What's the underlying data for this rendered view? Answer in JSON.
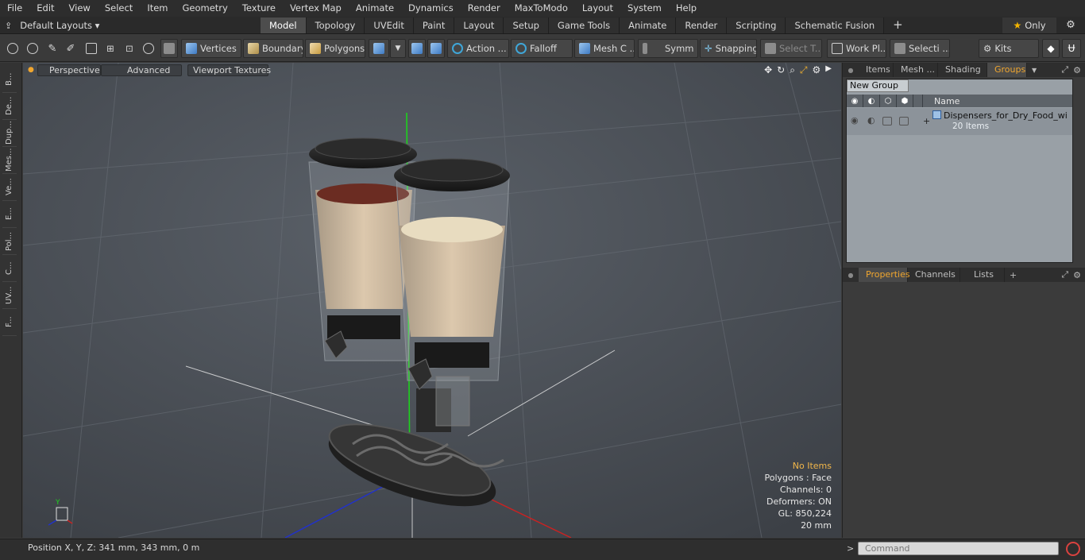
{
  "menu": [
    "File",
    "Edit",
    "View",
    "Select",
    "Item",
    "Geometry",
    "Texture",
    "Vertex Map",
    "Animate",
    "Dynamics",
    "Render",
    "MaxToModo",
    "Layout",
    "System",
    "Help"
  ],
  "layouts": {
    "label": "Default Layouts"
  },
  "tabs": [
    {
      "label": "Model",
      "active": true
    },
    {
      "label": "Topology",
      "active": false
    },
    {
      "label": "UVEdit",
      "active": false
    },
    {
      "label": "Paint",
      "active": false
    },
    {
      "label": "Layout",
      "active": false
    },
    {
      "label": "Setup",
      "active": false
    },
    {
      "label": "Game Tools",
      "active": false
    },
    {
      "label": "Animate",
      "active": false
    },
    {
      "label": "Render",
      "active": false
    },
    {
      "label": "Scripting",
      "active": false
    },
    {
      "label": "Schematic Fusion",
      "active": false
    }
  ],
  "only_label": "Only",
  "toolbar": {
    "vertices": "Vertices",
    "boundary": "Boundary",
    "polygons": "Polygons",
    "action": "Action ...",
    "falloff": "Falloff",
    "meshc": "Mesh C ...",
    "symm": "Symm ...",
    "snapping": "Snapping",
    "selectt": "Select T...",
    "workpl": "Work Pl...",
    "selecti": "Selecti ...",
    "kits": "Kits"
  },
  "left_tabs": [
    "B...",
    "De...",
    "Dup...",
    "Mes...",
    "Ve...",
    "E...",
    "Pol...",
    "C...",
    "UV...",
    "F..."
  ],
  "viewport": {
    "perspective": "Perspective",
    "advanced": "Advanced",
    "textures": "Viewport Textures",
    "stats": {
      "no_items": "No Items",
      "polygons": "Polygons : Face",
      "channels": "Channels: 0",
      "deformers": "Deformers: ON",
      "gl": "GL: 850,224",
      "unit": "20 mm"
    }
  },
  "right_tabs_top": [
    "Items",
    "Mesh ...",
    "Shading",
    "Groups"
  ],
  "groups": {
    "new_group": "New Group",
    "name_header": "Name",
    "item_name": "Dispensers_for_Dry_Food_wi ...",
    "item_count": "20 Items"
  },
  "right_tabs_bottom": [
    "Properties",
    "Channels",
    "Lists"
  ],
  "status": {
    "position": "Position X, Y, Z:  341 mm, 343 mm, 0 m"
  },
  "command": {
    "placeholder": "Command"
  },
  "colors": {
    "accent": "#f0a62f",
    "stat_warn": "#f1b64a"
  }
}
